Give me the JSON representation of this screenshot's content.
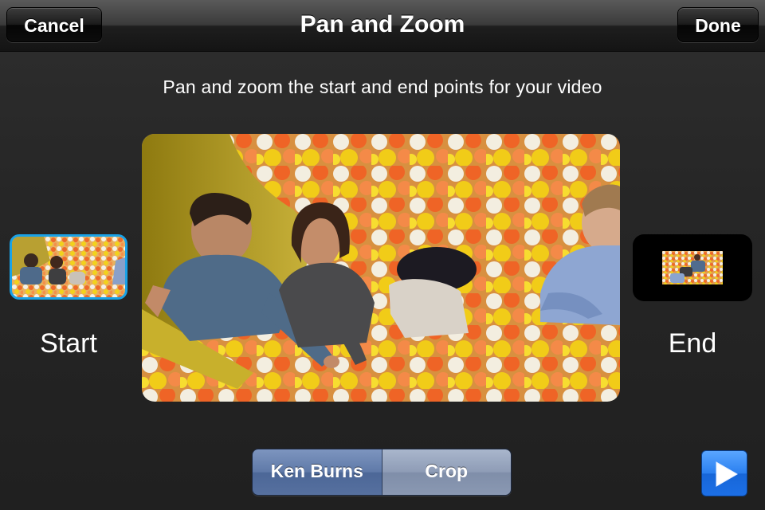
{
  "navbar": {
    "title": "Pan and Zoom",
    "cancel_label": "Cancel",
    "done_label": "Done"
  },
  "instruction": "Pan and zoom the start and end points for your video",
  "thumbnails": {
    "start_label": "Start",
    "end_label": "End",
    "selected": "start"
  },
  "segmented": {
    "options": [
      "Ken Burns",
      "Crop"
    ],
    "selected": "Ken Burns"
  },
  "play_icon": "play-icon",
  "colors": {
    "selection_border": "#1aa2e6",
    "segment_active": "#5f79a8",
    "play_button": "#2a7ff0"
  }
}
